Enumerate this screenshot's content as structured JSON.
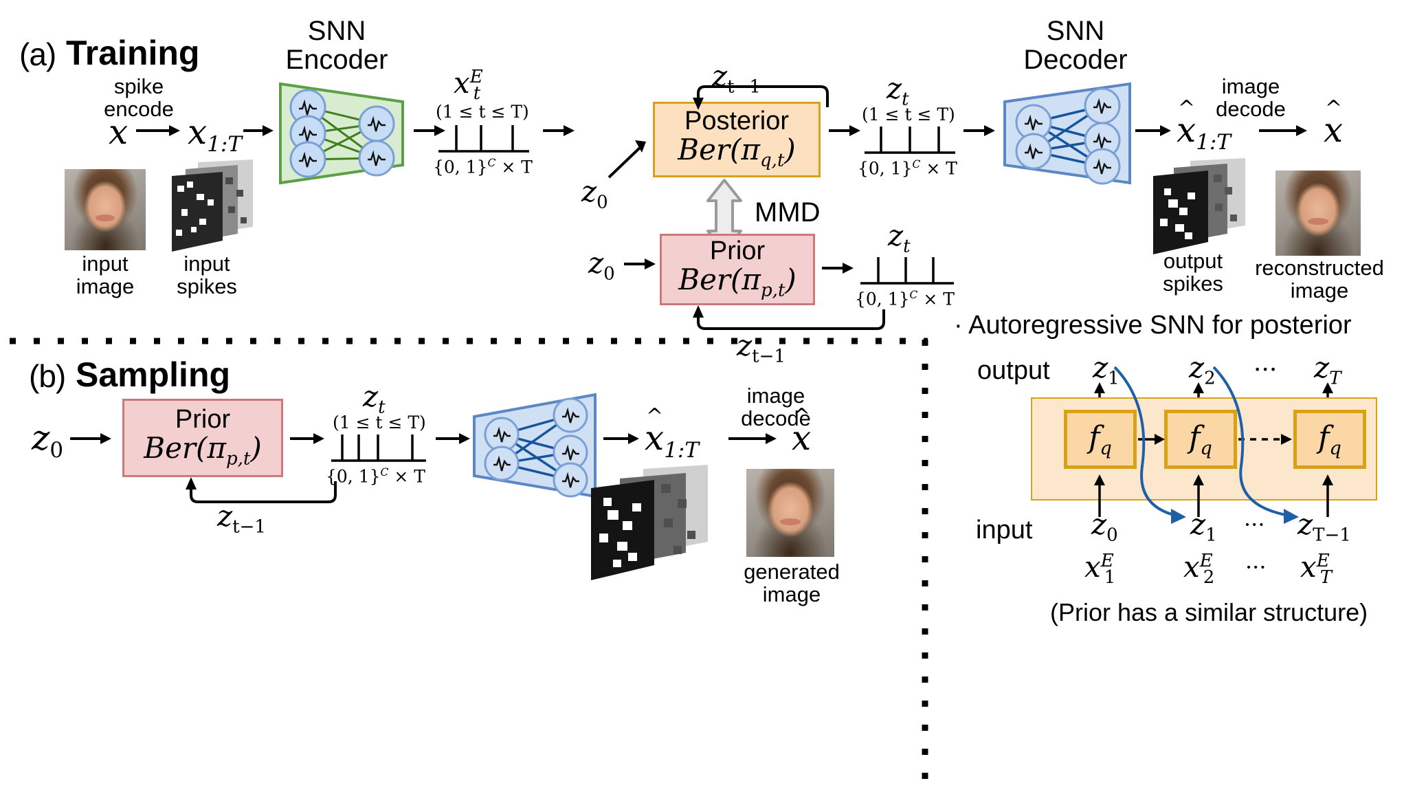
{
  "figure": {
    "panels": [
      {
        "tag": "(a)",
        "title": "Training"
      },
      {
        "tag": "(b)",
        "title": "Sampling"
      }
    ]
  },
  "colors": {
    "encoder_fill": "#d8ecd0",
    "encoder_stroke": "#5c9f45",
    "encoder_edge": "#3f7d1e",
    "decoder_fill": "#cfe0f5",
    "decoder_stroke": "#5b87c4",
    "decoder_edge": "#16559b",
    "neuron_fill": "#c7dcf5",
    "neuron_stroke": "#7a9fd4",
    "posterior_fill": "#fde0c0",
    "posterior_stroke": "#d9a116",
    "prior_fill": "#f3cfcf",
    "prior_stroke": "#c97a7a",
    "ar_band_fill": "#fde7cc",
    "ar_box_fill": "#fbd7a6",
    "ar_arrow_blue": "#1f5fa8",
    "mmd_arrow_fill": "#ededed",
    "mmd_arrow_stroke": "#9a9a9a"
  },
  "training": {
    "spike_encode_label": "spike\nencode",
    "spike_encode_line1": "spike",
    "spike_encode_line2": "encode",
    "x_symbol": "x",
    "x_sequence": "x",
    "x_sequence_sub": "1:T",
    "input_image_line1": "input",
    "input_image_line2": "image",
    "input_spikes_line1": "input",
    "input_spikes_line2": "spikes",
    "encoder_title_line1": "SNN",
    "encoder_title_line2": "Encoder",
    "xE_base": "x",
    "xE_sup": "E",
    "xE_sub": "t",
    "range_note": "(1 ≤ t ≤ T)",
    "set_note": "{0, 1}",
    "set_note_sup": "C",
    "set_note_tail": "× T",
    "z0_label": "z",
    "z0_sub": "0",
    "posterior_name": "Posterior",
    "posterior_math": "Ber(π",
    "posterior_math_sub": "q,t",
    "posterior_math_tail": ")",
    "zt_label": "z",
    "zt_sub": "t",
    "ztm1_label": "z",
    "ztm1_sub": "t−1",
    "mmd_label": "MMD",
    "prior_name": "Prior",
    "prior_math": "Ber(π",
    "prior_math_sub": "p,t",
    "prior_math_tail": ")",
    "decoder_title_line1": "SNN",
    "decoder_title_line2": "Decoder",
    "image_decode_line1": "image",
    "image_decode_line2": "decode",
    "xhat_seq": "x",
    "xhat_seq_sub": "1:T",
    "xhat": "x",
    "output_spikes_line1": "output",
    "output_spikes_line2": "spikes",
    "reconstructed_line1": "reconstructed",
    "reconstructed_line2": "image"
  },
  "sampling": {
    "z0_label": "z",
    "z0_sub": "0",
    "prior_name": "Prior",
    "prior_math": "Ber(π",
    "prior_math_sub": "p,t",
    "prior_math_tail": ")",
    "ztm1_label": "z",
    "ztm1_sub": "t−1",
    "zt_label": "z",
    "zt_sub": "t",
    "range_note": "(1 ≤ t ≤ T)",
    "set_note": "{0, 1}",
    "set_note_sup": "C",
    "set_note_tail": "× T",
    "image_decode_line1": "image",
    "image_decode_line2": "decode",
    "xhat_seq": "x",
    "xhat_seq_sub": "1:T",
    "xhat": "x",
    "generated_line1": "generated",
    "generated_line2": "image"
  },
  "autoregressive": {
    "heading_bullet": "·",
    "heading": "Autoregressive SNN for posterior",
    "output_label": "output",
    "input_label": "input",
    "footnote": "(Prior has a similar structure)",
    "outputs": [
      {
        "base": "z",
        "sub": "1"
      },
      {
        "base": "z",
        "sub": "2"
      },
      {
        "base": "z",
        "sub": "T"
      }
    ],
    "ellipsis": "···",
    "cells": [
      "f",
      "f",
      "f"
    ],
    "cell_sub": "q",
    "inputs_top": [
      {
        "base": "z",
        "sub": "0"
      },
      {
        "base": "z",
        "sub": "1"
      },
      {
        "base": "z",
        "sub": "T−1"
      }
    ],
    "inputs_bottom": [
      {
        "base": "x",
        "sup": "E",
        "sub": "1"
      },
      {
        "base": "x",
        "sup": "E",
        "sub": "2"
      },
      {
        "base": "x",
        "sup": "E",
        "sub": "T"
      }
    ]
  }
}
